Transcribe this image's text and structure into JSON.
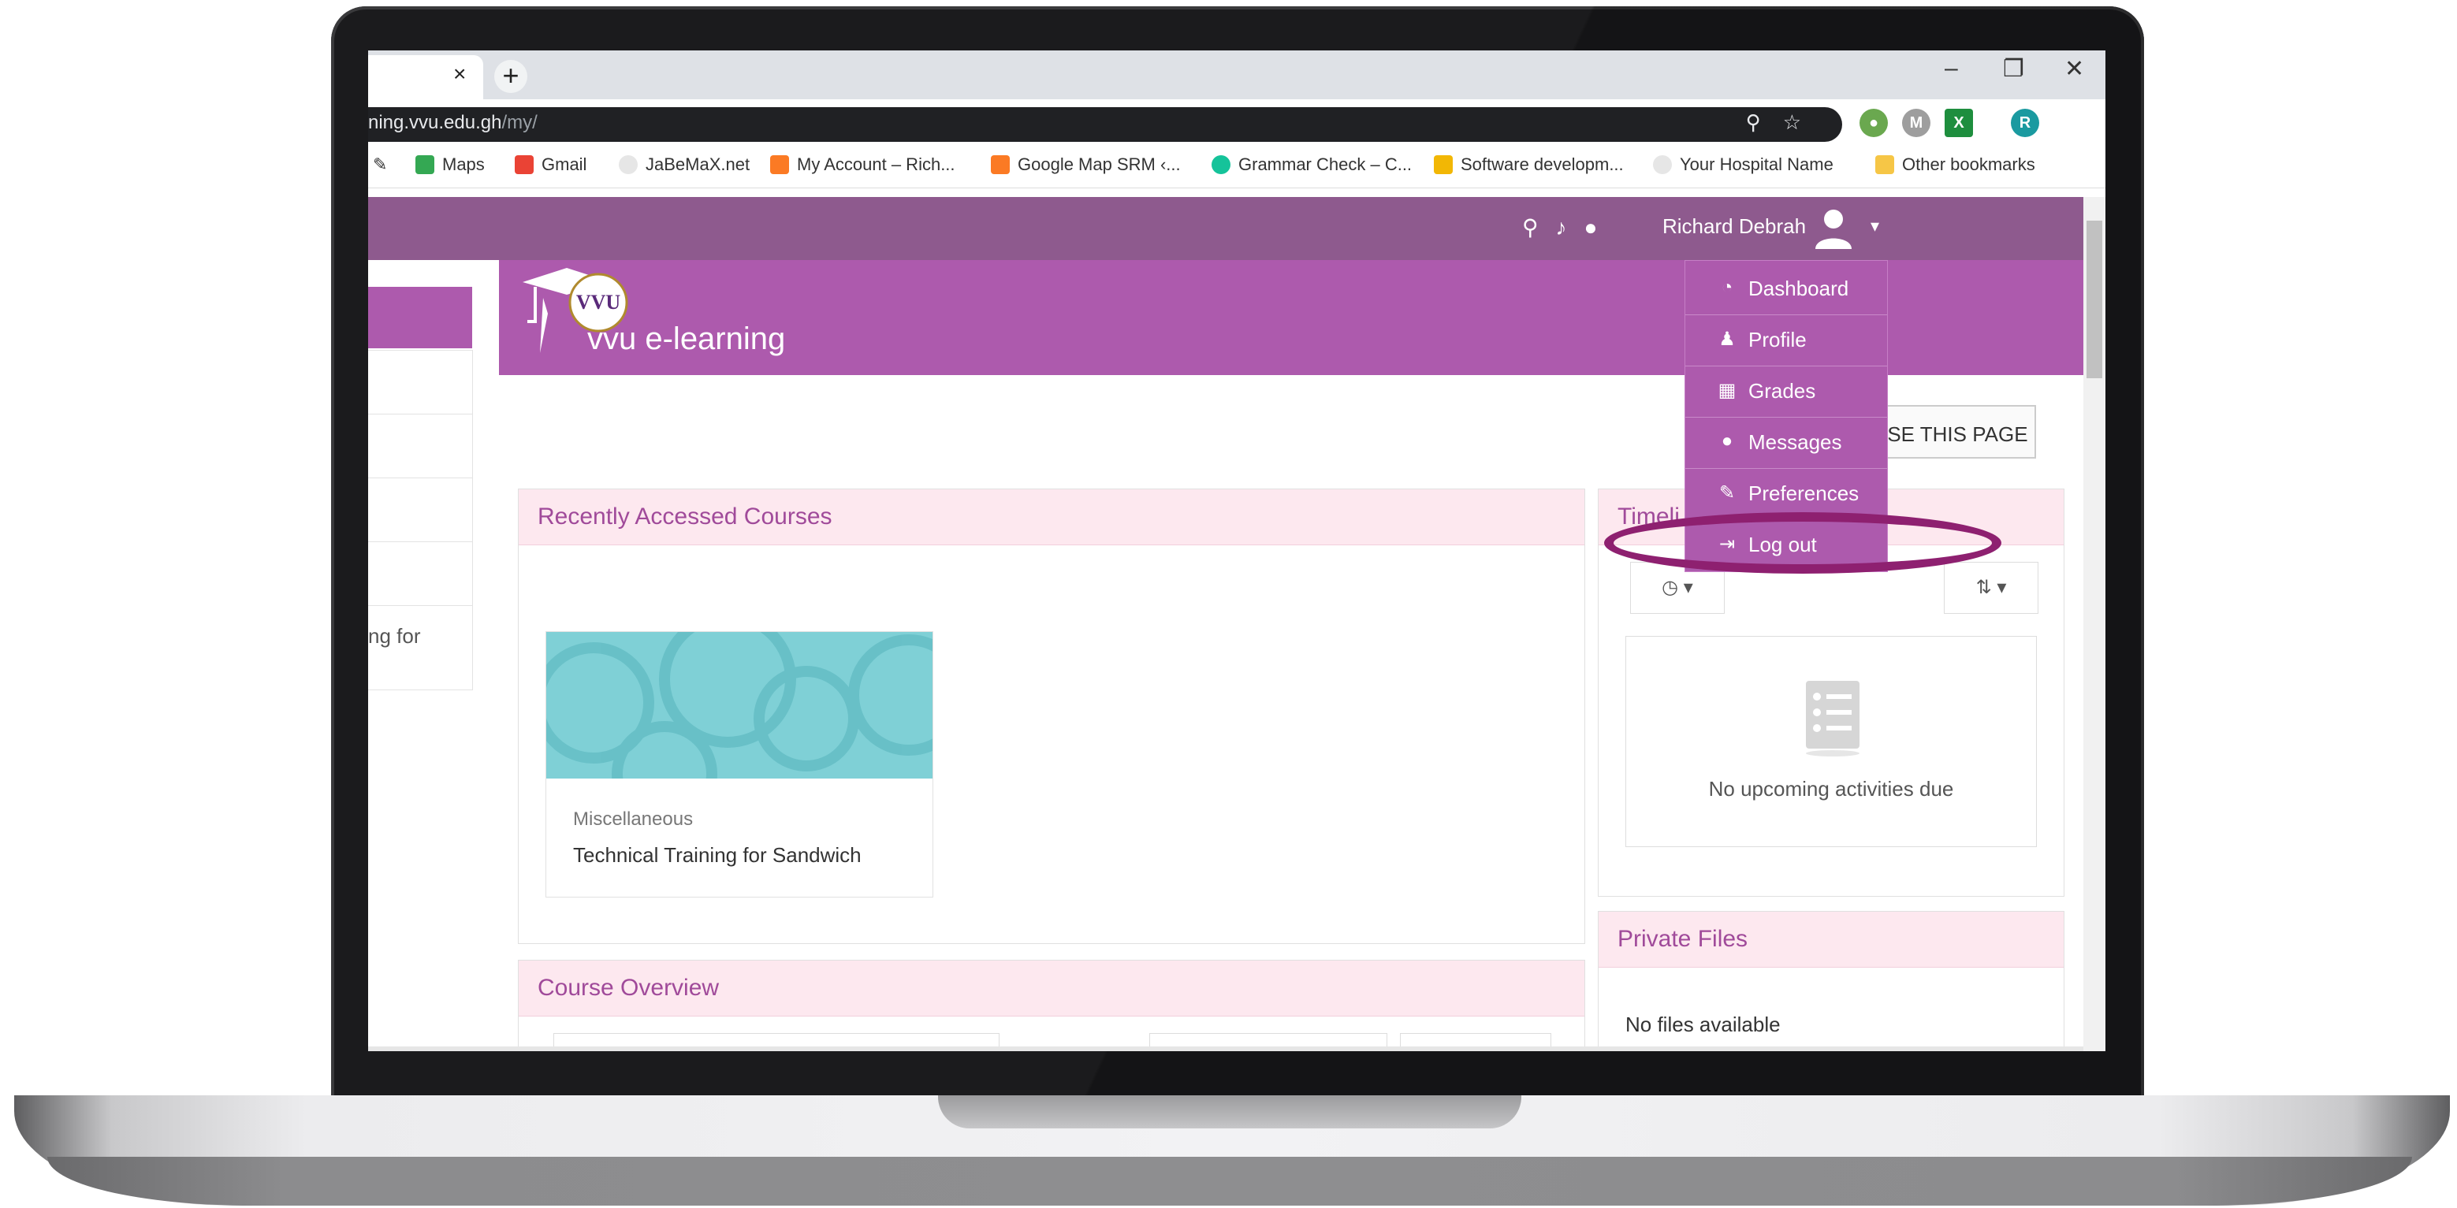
{
  "browser": {
    "tab_close": "×",
    "new_tab": "+",
    "controls": [
      "–",
      "❐",
      "✕"
    ],
    "url_host": "ning.vvu.edu.gh",
    "url_path": "/my/",
    "profile_initial": "R"
  },
  "bookmarks": [
    {
      "label": "Maps",
      "icon": "maps-icon",
      "color": "#34a853"
    },
    {
      "label": "Gmail",
      "icon": "gmail-icon",
      "color": "#ea4335"
    },
    {
      "label": "JaBeMaX.net",
      "icon": "globe-icon",
      "color": "#e6e6e6"
    },
    {
      "label": "My Account – Rich...",
      "icon": "xampp-icon",
      "color": "#fb7a24"
    },
    {
      "label": "Google Map SRM ‹...",
      "icon": "xampp-icon",
      "color": "#fb7a24"
    },
    {
      "label": "Grammar Check – C...",
      "icon": "grammarly-icon",
      "color": "#15c39a"
    },
    {
      "label": "Software developm...",
      "icon": "bolt-icon",
      "color": "#f2b705"
    },
    {
      "label": "Your Hospital Name",
      "icon": "globe-icon",
      "color": "#e6e6e6"
    },
    {
      "label": "Other bookmarks",
      "icon": "folder-icon",
      "color": "#f6c646"
    }
  ],
  "navbar": {
    "user_name": "Richard Debrah"
  },
  "site": {
    "logo_text": "VVU",
    "name": "vvu e-learning"
  },
  "drawer": {
    "partial_text": "ng for"
  },
  "page": {
    "customise_label": "MISE THIS PAGE"
  },
  "recent": {
    "title": "Recently Accessed Courses",
    "course_category": "Miscellaneous",
    "course_name": "Technical Training for Sandwich"
  },
  "overview": {
    "title": "Course Overview"
  },
  "timeline": {
    "title": "Timeli",
    "empty_text": "No upcoming activities due"
  },
  "private_files": {
    "title": "Private Files",
    "empty_text": "No files available"
  },
  "user_menu": [
    {
      "label": "Dashboard",
      "icon": "dashboard-icon",
      "glyph": "◔"
    },
    {
      "label": "Profile",
      "icon": "user-icon",
      "glyph": "♟"
    },
    {
      "label": "Grades",
      "icon": "grades-table-icon",
      "glyph": "▦"
    },
    {
      "label": "Messages",
      "icon": "chat-bubble-icon",
      "glyph": "●"
    },
    {
      "label": "Preferences",
      "icon": "wrench-icon",
      "glyph": "✎"
    },
    {
      "label": "Log out",
      "icon": "sign-out-icon",
      "glyph": "⇥"
    }
  ],
  "colors": {
    "navbar": "#8e5a8e",
    "brand": "#ad5aad",
    "card_header": "#fde8ef",
    "highlight_ring": "#8e2070"
  }
}
